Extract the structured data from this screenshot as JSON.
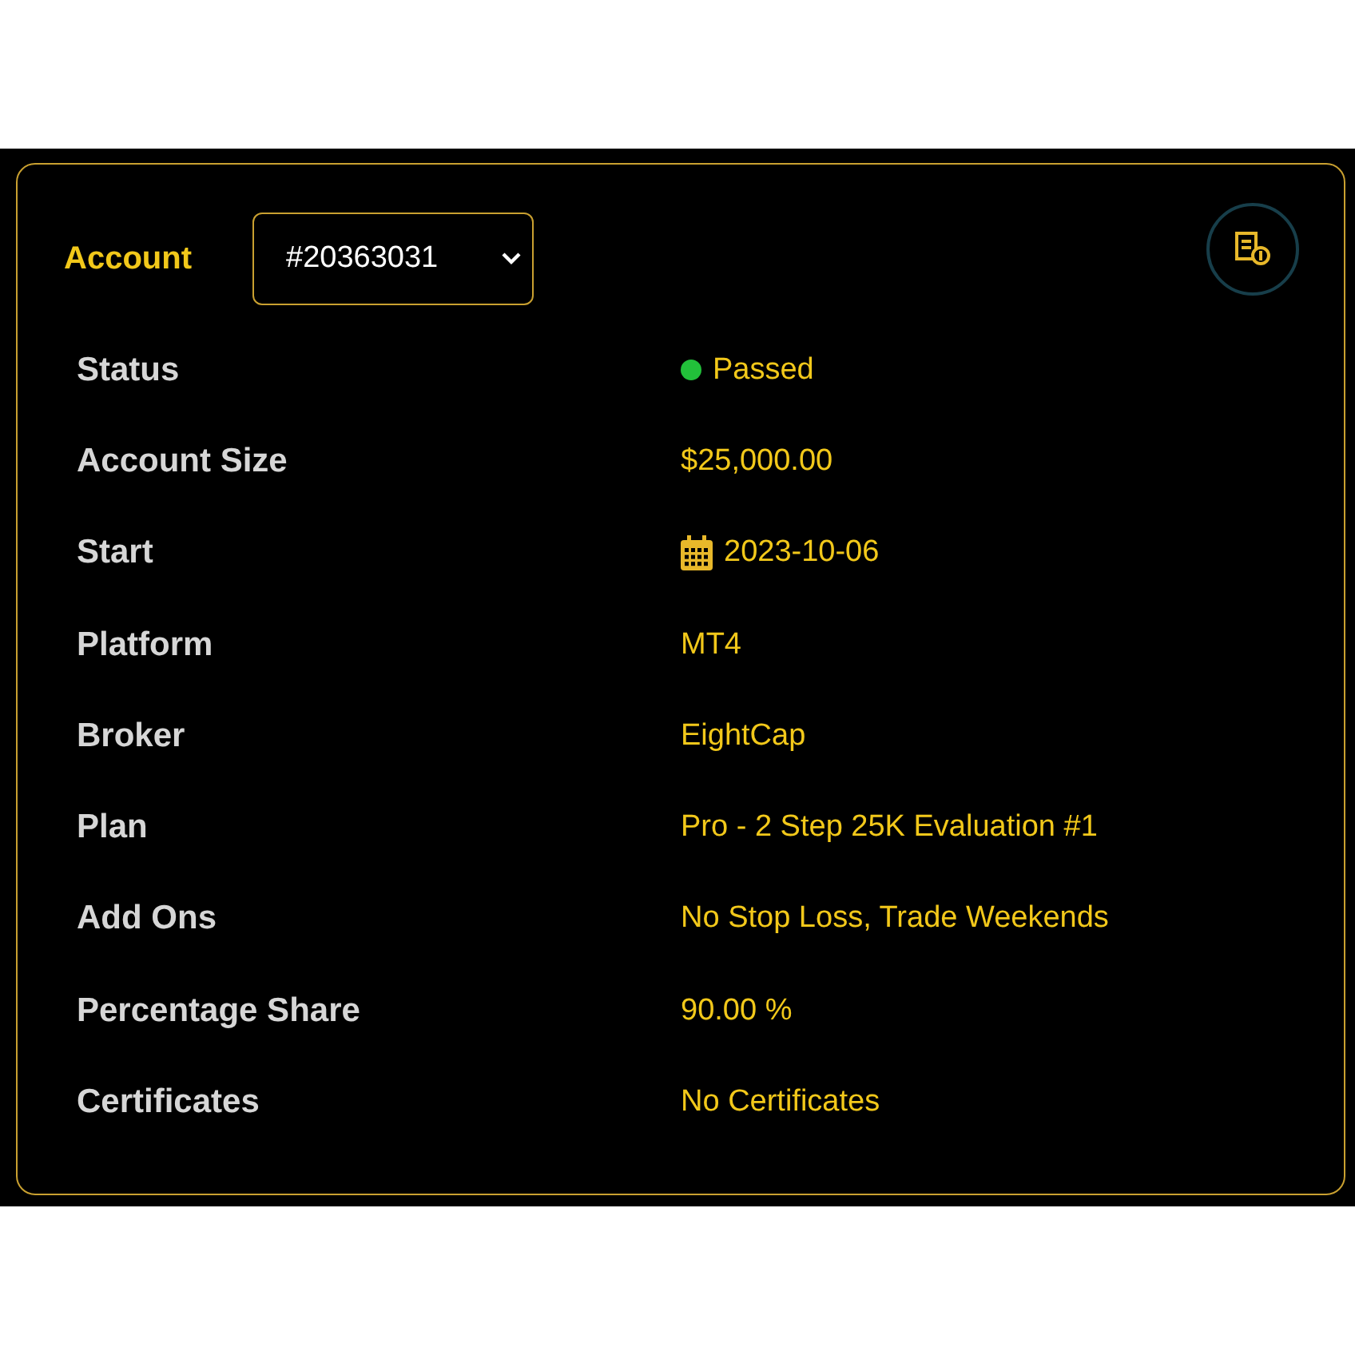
{
  "account": {
    "label": "Account",
    "selected_value": "#20363031"
  },
  "details": [
    {
      "label": "Status",
      "value": "Passed",
      "kind": "status",
      "color": "#22c03a"
    },
    {
      "label": "Account Size",
      "value": "$25,000.00",
      "kind": "text"
    },
    {
      "label": "Start",
      "value": "2023-10-06",
      "kind": "date"
    },
    {
      "label": "Platform",
      "value": "MT4",
      "kind": "text"
    },
    {
      "label": "Broker",
      "value": "EightCap",
      "kind": "text"
    },
    {
      "label": "Plan",
      "value": "Pro - 2 Step 25K Evaluation #1",
      "kind": "text"
    },
    {
      "label": "Add Ons",
      "value": "No Stop Loss, Trade Weekends",
      "kind": "text"
    },
    {
      "label": "Percentage Share",
      "value": "90.00 %",
      "kind": "text"
    },
    {
      "label": "Certificates",
      "value": "No Certificates",
      "kind": "text"
    }
  ]
}
